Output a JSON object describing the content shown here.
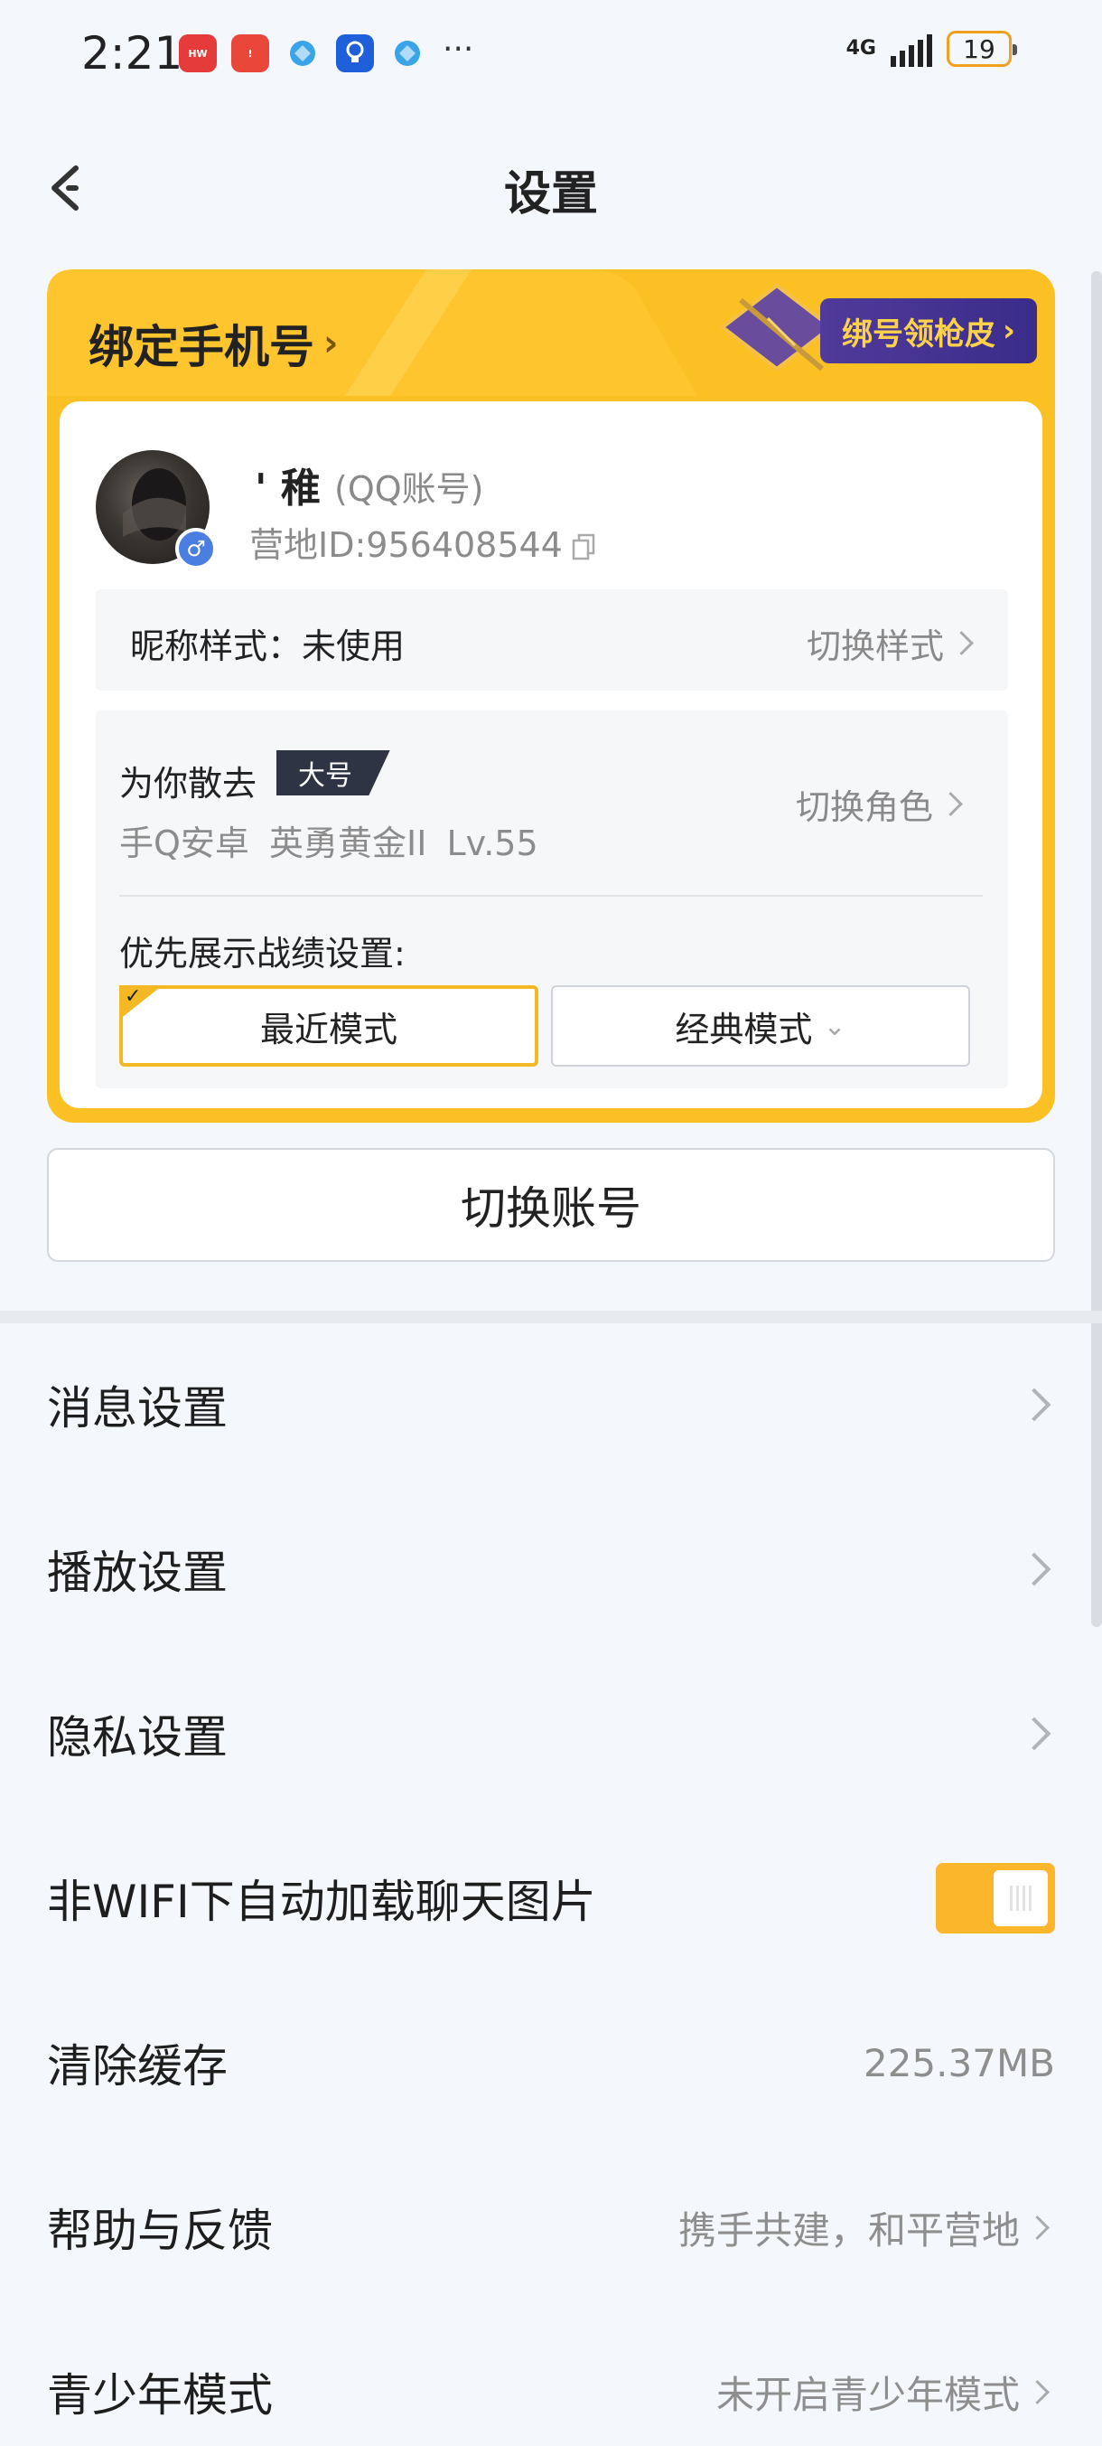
{
  "status_bar": {
    "time": "2:21",
    "network": "4G",
    "battery": "19",
    "more": "···",
    "app_icons": [
      "huawei-icon",
      "alert-app-icon",
      "browser-icon",
      "bulb-app-icon",
      "browser-icon-2"
    ]
  },
  "header": {
    "title": "设置"
  },
  "card": {
    "bind_phone": "绑定手机号",
    "promo": "绑号领枪皮",
    "nickname": "' 稚",
    "account_type": "(QQ账号)",
    "camp_id": "营地ID:956408544",
    "nick_style_label": "昵称样式：未使用",
    "nick_style_switch": "切换样式",
    "role_name": "为你散去",
    "role_badge": "大号",
    "role_info": "手Q安卓  英勇黄金II  Lv.55",
    "role_switch": "切换角色",
    "record_label": "优先展示战绩设置:",
    "mode_recent": "最近模式",
    "mode_classic": "经典模式"
  },
  "switch_account": "切换账号",
  "settings": [
    {
      "label": "消息设置"
    },
    {
      "label": "播放设置"
    },
    {
      "label": "隐私设置"
    },
    {
      "label": "非WIFI下自动加载聊天图片",
      "toggle": true
    },
    {
      "label": "清除缓存",
      "value": "225.37MB"
    },
    {
      "label": "帮助与反馈",
      "value": "携手共建，和平营地"
    },
    {
      "label": "青少年模式",
      "value": "未开启青少年模式"
    }
  ],
  "colors": {
    "accent": "#fbc024",
    "promo_bg": "#3a2c8a",
    "text": "#1e1e1e",
    "muted": "#8e8e8e"
  }
}
